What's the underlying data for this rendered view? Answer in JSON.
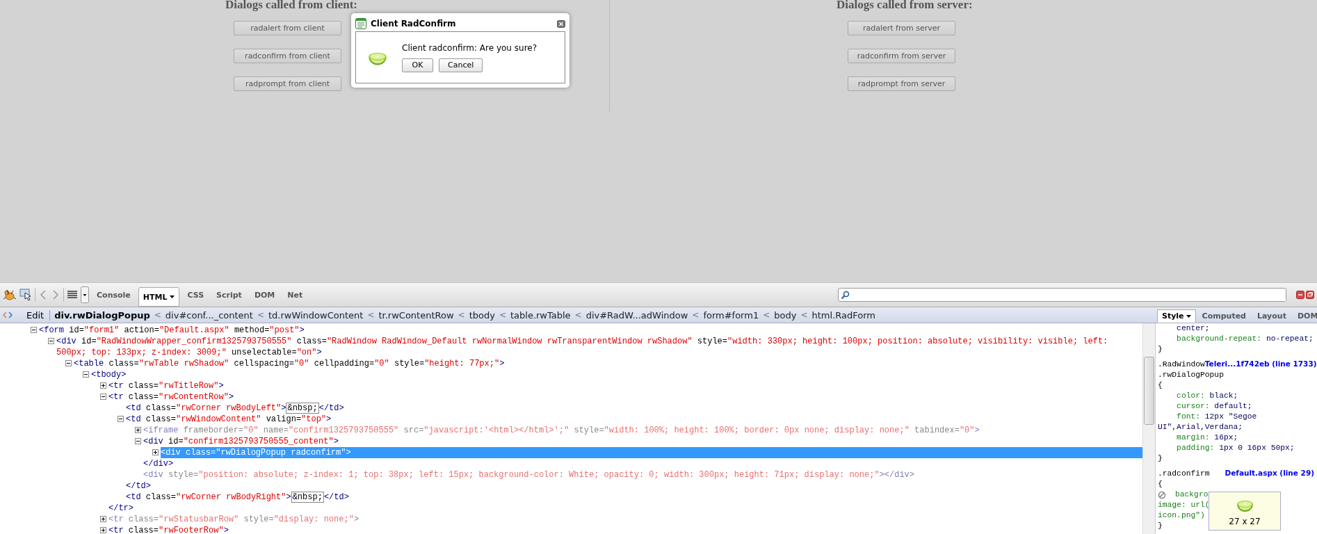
{
  "page": {
    "columns": [
      {
        "heading": "Dialogs called from client:",
        "buttons": [
          "radalert from client",
          "radconfirm from client",
          "radprompt from client"
        ]
      },
      {
        "heading": "Dialogs called from server:",
        "buttons": [
          "radalert from server",
          "radconfirm from server",
          "radprompt from server"
        ]
      }
    ]
  },
  "dialog": {
    "title": "Client RadConfirm",
    "message": "Client radconfirm: Are you sure?",
    "buttons": [
      "OK",
      "Cancel"
    ]
  },
  "devtools": {
    "tabs": [
      {
        "label": "Console",
        "selected": false,
        "menu": false
      },
      {
        "label": "HTML",
        "selected": true,
        "menu": true
      },
      {
        "label": "CSS",
        "selected": false,
        "menu": false
      },
      {
        "label": "Script",
        "selected": false,
        "menu": false
      },
      {
        "label": "DOM",
        "selected": false,
        "menu": false
      },
      {
        "label": "Net",
        "selected": false,
        "menu": false
      }
    ],
    "breadcrumb": {
      "edit_label": "Edit",
      "separator": "<",
      "items": [
        {
          "label": "div.rwDialogPopup",
          "selected": true
        },
        {
          "label": "div#conf..._content",
          "selected": false
        },
        {
          "label": "td.rwWindowContent",
          "selected": false
        },
        {
          "label": "tr.rwContentRow",
          "selected": false
        },
        {
          "label": "tbody",
          "selected": false
        },
        {
          "label": "table.rwTable",
          "selected": false
        },
        {
          "label": "div#RadW...adWindow",
          "selected": false
        },
        {
          "label": "form#form1",
          "selected": false
        },
        {
          "label": "body",
          "selected": false
        },
        {
          "label": "html.RadForm",
          "selected": false
        }
      ]
    },
    "html_tree": [
      {
        "open": "<form id=\"form1\" action=\"Default.aspx\" method=\"post\">",
        "expanded": true,
        "selected": false,
        "dimmed": false,
        "children": [
          {
            "open": "<div id=\"RadWindowWrapper_confirm1325793750555\" class=\"RadWindow RadWindow_Default rwNormalWindow rwTransparentWindow rwShadow\" style=\"width: 330px; height: 100px; position: absolute; visibility: visible; left: 500px; top: 133px; z-index: 3009;\" unselectable=\"on\">",
            "expanded": true,
            "selected": false,
            "dimmed": false,
            "children": [
              {
                "open": "<table class=\"rwTable rwShadow\" cellspacing=\"0\" cellpadding=\"0\" style=\"height: 77px;\">",
                "expanded": true,
                "selected": false,
                "dimmed": false,
                "children": [
                  {
                    "open": "<tbody>",
                    "expanded": true,
                    "selected": false,
                    "dimmed": false,
                    "children": [
                      {
                        "open": "<tr class=\"rwTitleRow\">",
                        "expanded": false,
                        "selected": false,
                        "dimmed": false
                      },
                      {
                        "open": "<tr class=\"rwContentRow\">",
                        "expanded": true,
                        "selected": false,
                        "dimmed": false,
                        "close": "</tr>",
                        "children": [
                          {
                            "open": "<td class=\"rwCorner rwBodyLeft\">",
                            "content": "&nbsp;",
                            "close": "</td>",
                            "selected": false,
                            "dimmed": false
                          },
                          {
                            "open": "<td class=\"rwWindowContent\" valign=\"top\">",
                            "expanded": true,
                            "selected": false,
                            "dimmed": false,
                            "close": "</td>",
                            "children": [
                              {
                                "open": "<iframe frameborder=\"0\" name=\"confirm1325793750555\" src=\"javascript:'<html></html>';\" style=\"width: 100%; height: 100%; border: 0px none; display: none;\" tabindex=\"0\">",
                                "expanded": false,
                                "selected": false,
                                "dimmed": true
                              },
                              {
                                "open": "<div id=\"confirm1325793750555_content\">",
                                "expanded": true,
                                "selected": false,
                                "dimmed": false,
                                "close": "</div>",
                                "children": [
                                  {
                                    "open": "<div class=\"rwDialogPopup radconfirm\">",
                                    "expanded": false,
                                    "selected": true,
                                    "dimmed": false
                                  }
                                ]
                              },
                              {
                                "open": "<div style=\"position: absolute; z-index: 1; top: 38px; left: 15px; background-color: White; opacity: 0; width: 300px; height: 71px; display: none;\">",
                                "close": "</div>",
                                "selected": false,
                                "dimmed": true
                              }
                            ]
                          },
                          {
                            "open": "<td class=\"rwCorner rwBodyRight\">",
                            "content": "&nbsp;",
                            "close": "</td>",
                            "selected": false,
                            "dimmed": false
                          }
                        ]
                      },
                      {
                        "open": "<tr class=\"rwStatusbarRow\" style=\"display: none;\">",
                        "expanded": false,
                        "selected": false,
                        "dimmed": true
                      },
                      {
                        "open": "<tr class=\"rwFooterRow\">",
                        "expanded": false,
                        "selected": false,
                        "dimmed": false
                      }
                    ]
                  }
                ]
              }
            ]
          }
        ]
      }
    ],
    "side_tabs": [
      {
        "label": "Style",
        "selected": true,
        "menu": true
      },
      {
        "label": "Computed",
        "selected": false,
        "menu": false
      },
      {
        "label": "Layout",
        "selected": false,
        "menu": false
      },
      {
        "label": "DOM",
        "selected": false,
        "menu": false
      }
    ],
    "style_rules": [
      {
        "declarations": [
          {
            "value": "center;",
            "disabled": false
          },
          {
            "property": "background-repeat:",
            "value": "no-repeat;",
            "disabled": false
          }
        ],
        "close": "}"
      },
      {
        "selector": [
          ".RadWindow",
          ".rwDialogPopup"
        ],
        "source": "Teleri...1f742eb (line 1733)",
        "open": "{",
        "declarations": [
          {
            "property": "color:",
            "value": "black;",
            "disabled": false
          },
          {
            "property": "cursor:",
            "value": "default;",
            "disabled": false
          },
          {
            "property": "font:",
            "value": "12px \"Segoe UI\",Arial,Verdana;",
            "disabled": false
          },
          {
            "property": "margin:",
            "value": "16px;",
            "disabled": false
          },
          {
            "property": "padding:",
            "value": "1px 0 16px 50px;",
            "disabled": false
          }
        ],
        "close": "}"
      },
      {
        "selector": [
          ".radconfirm"
        ],
        "source": "Default.aspx (line 29)",
        "open": "{",
        "declarations": [
          {
            "lines": [
              "backgro",
              "image: url(",
              "icon.png\")"
            ],
            "disabled": true
          }
        ],
        "close": "}"
      }
    ],
    "tooltip": {
      "text": "27 x 27"
    }
  }
}
